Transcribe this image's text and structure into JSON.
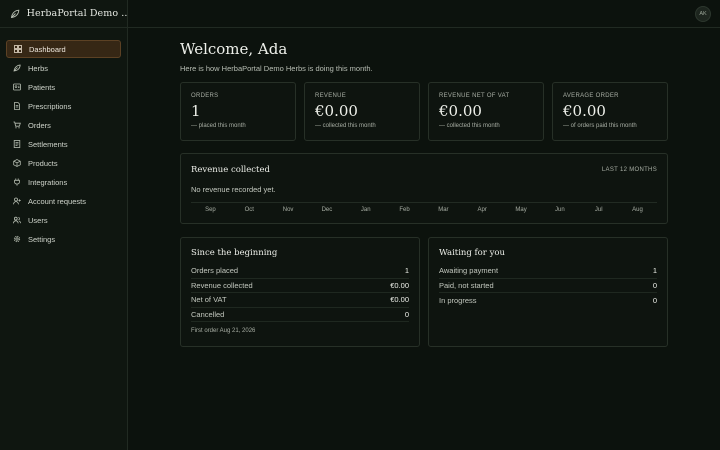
{
  "brand": {
    "name": "HerbaPortal Demo ...",
    "icon": "leaf-icon"
  },
  "nav": [
    {
      "label": "Dashboard",
      "icon": "grid-icon",
      "active": true
    },
    {
      "label": "Herbs",
      "icon": "leaf-icon"
    },
    {
      "label": "Patients",
      "icon": "id-card-icon"
    },
    {
      "label": "Prescriptions",
      "icon": "document-icon"
    },
    {
      "label": "Orders",
      "icon": "cart-icon"
    },
    {
      "label": "Settlements",
      "icon": "receipt-icon"
    },
    {
      "label": "Products",
      "icon": "box-icon"
    },
    {
      "label": "Integrations",
      "icon": "plug-icon"
    },
    {
      "label": "Account requests",
      "icon": "user-plus-icon"
    },
    {
      "label": "Users",
      "icon": "users-icon"
    },
    {
      "label": "Settings",
      "icon": "gear-icon"
    }
  ],
  "user": {
    "initials": "AK"
  },
  "header": {
    "title": "Welcome, Ada",
    "subtitle": "Here is how HerbaPortal Demo Herbs is doing this month."
  },
  "cards": [
    {
      "label": "ORDERS",
      "value": "1",
      "note": "—  placed this month"
    },
    {
      "label": "REVENUE",
      "value": "€0.00",
      "note": "—  collected this month"
    },
    {
      "label": "REVENUE NET OF VAT",
      "value": "€0.00",
      "note": "—  collected this month"
    },
    {
      "label": "AVERAGE ORDER",
      "value": "€0.00",
      "note": "—  of orders paid this month"
    }
  ],
  "revenue": {
    "title": "Revenue collected",
    "range": "LAST 12 MONTHS",
    "empty": "No revenue recorded yet.",
    "months": [
      "Sep",
      "Oct",
      "Nov",
      "Dec",
      "Jan",
      "Feb",
      "Mar",
      "Apr",
      "May",
      "Jun",
      "Jul",
      "Aug"
    ]
  },
  "since": {
    "title": "Since the beginning",
    "rows": [
      {
        "label": "Orders placed",
        "value": "1"
      },
      {
        "label": "Revenue collected",
        "value": "€0.00"
      },
      {
        "label": "Net of VAT",
        "value": "€0.00"
      },
      {
        "label": "Cancelled",
        "value": "0"
      }
    ],
    "first_order": "First order Aug 21, 2026"
  },
  "waiting": {
    "title": "Waiting for you",
    "rows": [
      {
        "label": "Awaiting payment",
        "value": "1"
      },
      {
        "label": "Paid, not started",
        "value": "0"
      },
      {
        "label": "In progress",
        "value": "0"
      }
    ]
  },
  "colors": {
    "accent": "#362715",
    "accent_border": "#5c4124",
    "background": "#0c120d"
  }
}
